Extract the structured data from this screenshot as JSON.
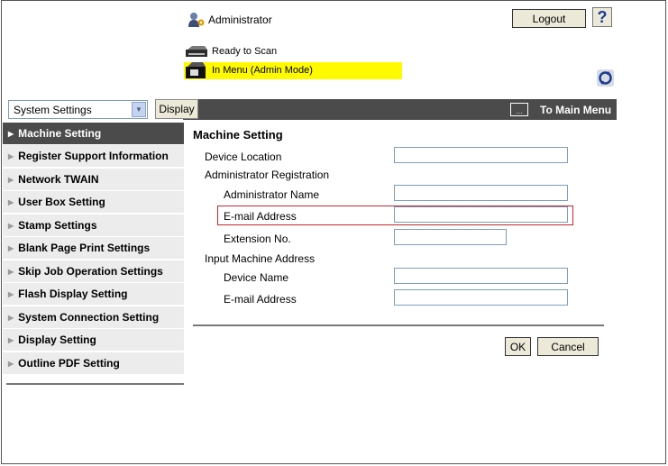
{
  "header": {
    "user_label": "Administrator",
    "logout_label": "Logout",
    "help_label": "?",
    "status_ready": "Ready to Scan",
    "status_menu": "In Menu (Admin Mode)",
    "highlight_color": "#fffa00"
  },
  "toolbar": {
    "select_value": "System Settings",
    "display_label": "Display",
    "to_main_menu_label": "To Main Menu"
  },
  "sidebar": {
    "items": [
      {
        "label": "Machine Setting"
      },
      {
        "label": "Register Support Information"
      },
      {
        "label": "Network TWAIN"
      },
      {
        "label": "User Box Setting"
      },
      {
        "label": "Stamp Settings"
      },
      {
        "label": "Blank Page Print Settings"
      },
      {
        "label": "Skip Job Operation Settings"
      },
      {
        "label": "Flash Display Setting"
      },
      {
        "label": "System Connection Setting"
      },
      {
        "label": "Display Setting"
      },
      {
        "label": "Outline PDF Setting"
      }
    ]
  },
  "main": {
    "title": "Machine Setting",
    "device_location_label": "Device Location",
    "device_location_value": "",
    "admin_registration_label": "Administrator Registration",
    "admin_name_label": "Administrator Name",
    "admin_name_value": "",
    "email_label": "E-mail Address",
    "email_value": "",
    "extension_label": "Extension No.",
    "extension_value": "",
    "input_machine_label": "Input Machine Address",
    "device_name_label": "Device Name",
    "device_name_value": "",
    "machine_email_label": "E-mail Address",
    "machine_email_value": "",
    "ok_label": "OK",
    "cancel_label": "Cancel"
  }
}
